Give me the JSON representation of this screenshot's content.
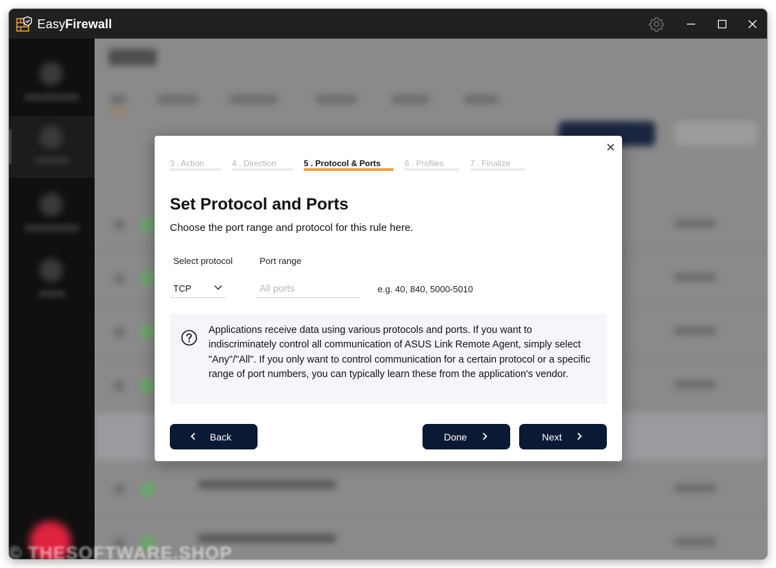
{
  "app": {
    "title_prefix": "Easy",
    "title_bold": "Firewall"
  },
  "titlebar": {
    "settings_icon": "gear-icon",
    "minimize_icon": "minimize-icon",
    "maximize_icon": "maximize-icon",
    "close_icon": "close-icon"
  },
  "wizard": {
    "steps": [
      {
        "label": "3 .  Action",
        "active": false
      },
      {
        "label": "4 .  Direction",
        "active": false
      },
      {
        "label": "5 .  Protocol & Ports",
        "active": true
      },
      {
        "label": "6 .  Profiles",
        "active": false
      },
      {
        "label": "7 .  Finalize",
        "active": false
      }
    ],
    "heading": "Set Protocol and Ports",
    "subheading": "Choose the port range and protocol for this rule here.",
    "protocol_label": "Select protocol",
    "protocol_value": "TCP",
    "port_label": "Port range",
    "port_placeholder": "All ports",
    "port_value": "",
    "port_hint": "e.g. 40, 840, 5000-5010",
    "info_text": "Applications receive data using various protocols and ports. If you want to indiscriminately control all communication of ASUS Link Remote Agent, simply select \"Any\"/\"All\". If you only want to control communication for a certain protocol or a specific range of port numbers, you can typically learn these from the application's vendor.",
    "back_label": "Back",
    "done_label": "Done",
    "next_label": "Next"
  },
  "colors": {
    "accent_orange": "#f2a23a",
    "button_navy": "#0a1a35",
    "info_bg": "#f5f6fa"
  },
  "watermark": "© THESOFTWARE.SHOP"
}
